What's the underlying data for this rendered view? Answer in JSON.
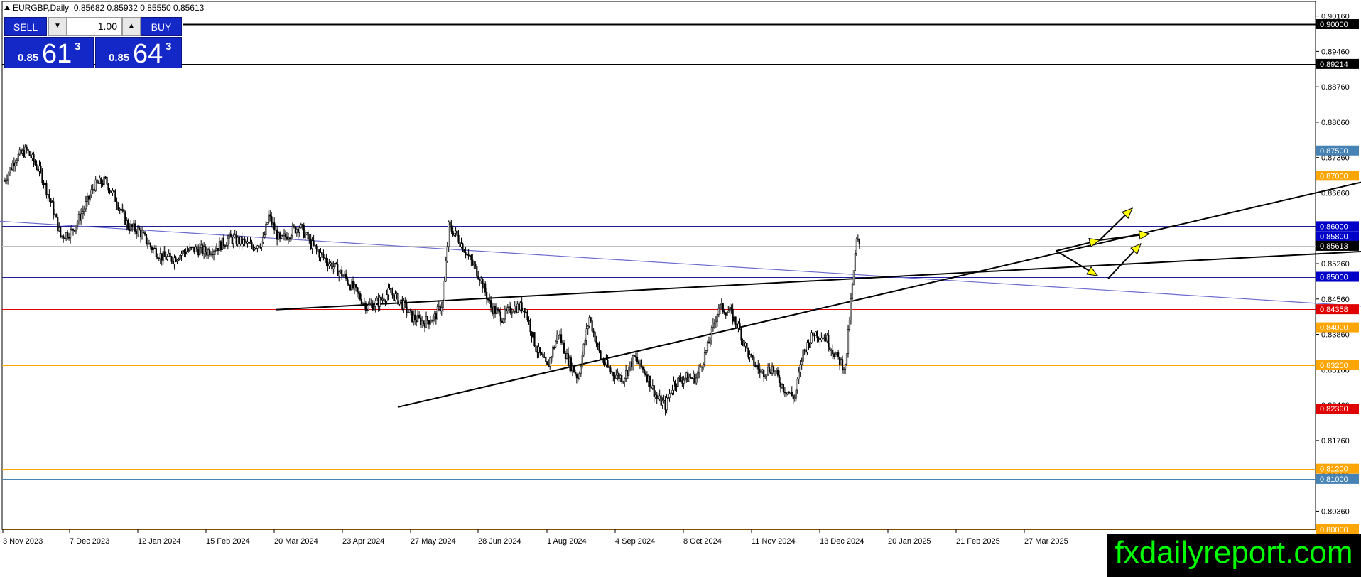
{
  "header": {
    "symbol": "EURGBP,Daily",
    "ohlc": "0.85682 0.85932 0.85550 0.85613"
  },
  "trade_panel": {
    "sell_label": "SELL",
    "buy_label": "BUY",
    "volume": "1.00",
    "sell_prefix": "0.85",
    "sell_big": "61",
    "sell_sup": "3",
    "buy_prefix": "0.85",
    "buy_big": "64",
    "buy_sup": "3"
  },
  "brand": "fxdailyreport.com",
  "colors": {
    "candle": "#000000",
    "orange_level": "#ffa500",
    "red_level": "#e00000",
    "blue_level": "#1e1e9a",
    "steel_level": "#4682b4",
    "black_level": "#000000",
    "trendline_blue": "#6a6ad0",
    "arrow_fill": "#ffff00"
  },
  "chart_data": {
    "type": "candlestick",
    "title": "EURGBP,Daily",
    "ylim": [
      0.8,
      0.9045
    ],
    "x_ticks": [
      "3 Nov 2023",
      "7 Dec 2023",
      "12 Jan 2024",
      "15 Feb 2024",
      "20 Mar 2024",
      "23 Apr 2024",
      "27 May 2024",
      "28 Jun 2024",
      "1 Aug 2024",
      "4 Sep 2024",
      "8 Oct 2024",
      "11 Nov 2024",
      "13 Dec 2024",
      "20 Jan 2025",
      "21 Feb 2025",
      "27 Mar 2025"
    ],
    "y_ticks": [
      "0.90160",
      "0.89460",
      "0.88760",
      "0.88060",
      "0.87360",
      "0.86660",
      "0.85960",
      "0.85260",
      "0.84560",
      "0.83860",
      "0.83160",
      "0.82460",
      "0.81760",
      "0.81060",
      "0.80360"
    ],
    "price_levels": [
      {
        "label": "0.90000",
        "value": 0.9,
        "color": "black"
      },
      {
        "label": "0.89214",
        "value": 0.89214,
        "color": "black"
      },
      {
        "label": "0.87500",
        "value": 0.875,
        "color": "steel"
      },
      {
        "label": "0.87000",
        "value": 0.87,
        "color": "orange"
      },
      {
        "label": "0.86000",
        "value": 0.86,
        "color": "blue"
      },
      {
        "label": "0.85800",
        "value": 0.858,
        "color": "blue"
      },
      {
        "label": "0.85613",
        "value": 0.85613,
        "color": "current"
      },
      {
        "label": "0.85000",
        "value": 0.85,
        "color": "blue"
      },
      {
        "label": "0.84358",
        "value": 0.84358,
        "color": "red"
      },
      {
        "label": "0.84000",
        "value": 0.84,
        "color": "orange"
      },
      {
        "label": "0.83250",
        "value": 0.8325,
        "color": "orange"
      },
      {
        "label": "0.82390",
        "value": 0.8239,
        "color": "red"
      },
      {
        "label": "0.81200",
        "value": 0.812,
        "color": "orange"
      },
      {
        "label": "0.81000",
        "value": 0.81,
        "color": "steel"
      },
      {
        "label": "0.80000",
        "value": 0.8,
        "color": "orange"
      }
    ],
    "close_path": [
      [
        0,
        0.869
      ],
      [
        8,
        0.8735
      ],
      [
        16,
        0.875
      ],
      [
        26,
        0.8705
      ],
      [
        34,
        0.864
      ],
      [
        40,
        0.858
      ],
      [
        48,
        0.859
      ],
      [
        56,
        0.863
      ],
      [
        64,
        0.868
      ],
      [
        72,
        0.869
      ],
      [
        80,
        0.865
      ],
      [
        88,
        0.86
      ],
      [
        96,
        0.859
      ],
      [
        104,
        0.856
      ],
      [
        112,
        0.854
      ],
      [
        120,
        0.8535
      ],
      [
        128,
        0.855
      ],
      [
        136,
        0.8555
      ],
      [
        144,
        0.855
      ],
      [
        152,
        0.856
      ],
      [
        160,
        0.8575
      ],
      [
        168,
        0.857
      ],
      [
        176,
        0.856
      ],
      [
        184,
        0.857
      ],
      [
        188,
        0.862
      ],
      [
        196,
        0.857
      ],
      [
        204,
        0.859
      ],
      [
        210,
        0.86
      ],
      [
        218,
        0.8565
      ],
      [
        226,
        0.854
      ],
      [
        234,
        0.852
      ],
      [
        242,
        0.85
      ],
      [
        250,
        0.847
      ],
      [
        258,
        0.844
      ],
      [
        266,
        0.845
      ],
      [
        274,
        0.847
      ],
      [
        282,
        0.845
      ],
      [
        290,
        0.842
      ],
      [
        298,
        0.841
      ],
      [
        306,
        0.842
      ],
      [
        312,
        0.845
      ],
      [
        316,
        0.86
      ],
      [
        322,
        0.858
      ],
      [
        330,
        0.854
      ],
      [
        338,
        0.85
      ],
      [
        346,
        0.844
      ],
      [
        354,
        0.842
      ],
      [
        362,
        0.844
      ],
      [
        370,
        0.844
      ],
      [
        378,
        0.836
      ],
      [
        386,
        0.832
      ],
      [
        394,
        0.839
      ],
      [
        400,
        0.834
      ],
      [
        408,
        0.83
      ],
      [
        416,
        0.842
      ],
      [
        424,
        0.834
      ],
      [
        432,
        0.831
      ],
      [
        440,
        0.83
      ],
      [
        448,
        0.834
      ],
      [
        456,
        0.831
      ],
      [
        464,
        0.826
      ],
      [
        470,
        0.8245
      ],
      [
        476,
        0.829
      ],
      [
        484,
        0.83
      ],
      [
        492,
        0.83
      ],
      [
        500,
        0.836
      ],
      [
        508,
        0.844
      ],
      [
        516,
        0.843
      ],
      [
        522,
        0.84
      ],
      [
        530,
        0.834
      ],
      [
        538,
        0.831
      ],
      [
        546,
        0.832
      ],
      [
        554,
        0.828
      ],
      [
        562,
        0.826
      ],
      [
        568,
        0.835
      ],
      [
        576,
        0.839
      ],
      [
        584,
        0.838
      ],
      [
        592,
        0.834
      ],
      [
        598,
        0.832
      ],
      [
        602,
        0.845
      ],
      [
        606,
        0.857
      ],
      [
        609,
        0.8561
      ]
    ],
    "overlays": [
      {
        "kind": "trendline",
        "from": [
          0,
          0.861
        ],
        "to": [
          1916,
          0.8442
        ],
        "color": "trendline_blue"
      },
      {
        "kind": "trendline",
        "from": [
          388,
          0.8435
        ],
        "to": [
          1916,
          0.855
        ],
        "color": "black"
      },
      {
        "kind": "trendline",
        "from": [
          560,
          0.8242
        ],
        "to": [
          1916,
          0.8687
        ],
        "color": "black"
      }
    ],
    "scenario_arrows": 5
  }
}
